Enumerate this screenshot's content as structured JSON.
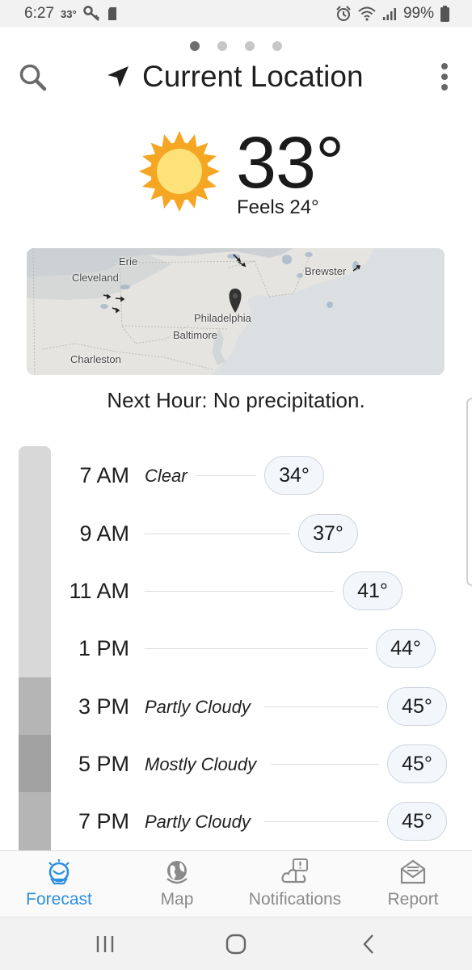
{
  "status_bar": {
    "time": "6:27",
    "temp": "33°",
    "battery": "99%"
  },
  "header": {
    "title": "Current Location",
    "page_count": 4,
    "active_page": 1
  },
  "current": {
    "temperature": "33°",
    "feels_like": "Feels 24°",
    "icon": "sun-icon"
  },
  "map": {
    "labels": {
      "erie": "Erie",
      "cleveland": "Cleveland",
      "brewster": "Brewster",
      "philadelphia": "Philadelphia",
      "baltimore": "Baltimore",
      "charleston": "Charleston"
    }
  },
  "next_hour": "Next Hour: No precipitation.",
  "hourly": [
    {
      "time": "7 AM",
      "condition": "Clear",
      "temp": "34°"
    },
    {
      "time": "9 AM",
      "condition": "",
      "temp": "37°"
    },
    {
      "time": "11 AM",
      "condition": "",
      "temp": "41°"
    },
    {
      "time": "1 PM",
      "condition": "",
      "temp": "44°"
    },
    {
      "time": "3 PM",
      "condition": "Partly Cloudy",
      "temp": "45°"
    },
    {
      "time": "5 PM",
      "condition": "Mostly Cloudy",
      "temp": "45°"
    },
    {
      "time": "7 PM",
      "condition": "Partly Cloudy",
      "temp": "45°"
    }
  ],
  "bottom_nav": {
    "forecast": "Forecast",
    "map": "Map",
    "notifications": "Notifications",
    "report": "Report",
    "active": "forecast"
  },
  "colors": {
    "accent": "#2d8fe0",
    "sun_outer": "#f5a623",
    "sun_inner": "#fde27a",
    "clear_bar": "#d8d8d8",
    "partly_cloudy_bar": "#b5b5b5",
    "mostly_cloudy_bar": "#a2a2a2"
  }
}
